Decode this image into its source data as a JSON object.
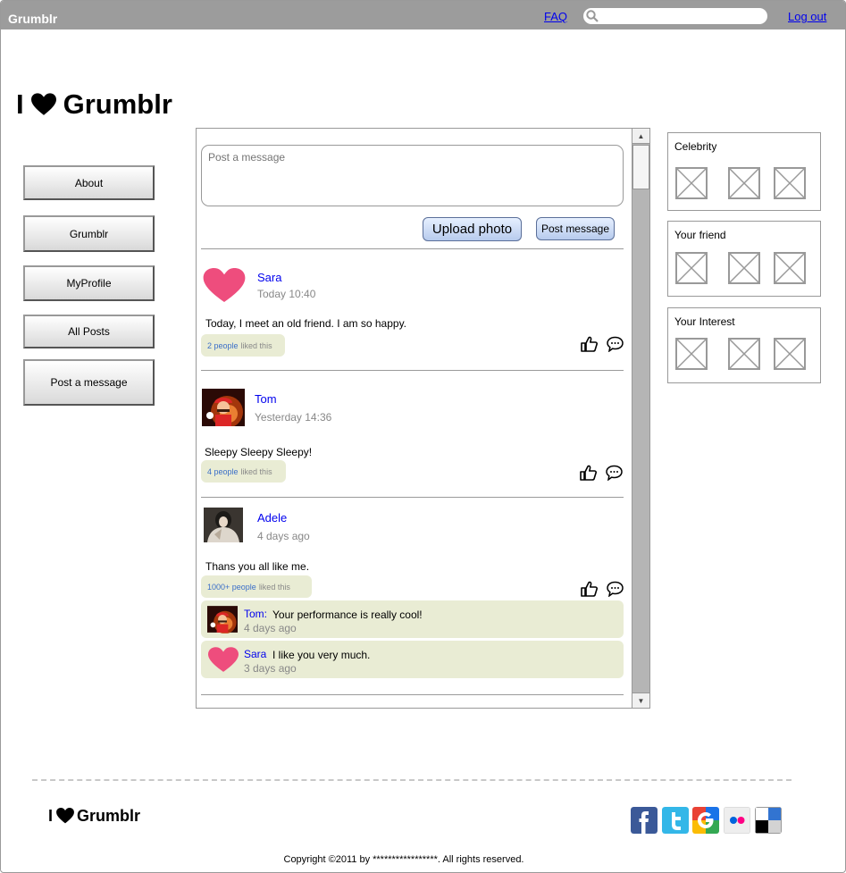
{
  "header": {
    "brand": "Grumblr",
    "faq": "FAQ",
    "search_placeholder": "",
    "logout": "Log out"
  },
  "logo": {
    "prefix": "I",
    "name": "Grumblr"
  },
  "nav": [
    {
      "label": "About"
    },
    {
      "label": "Grumblr"
    },
    {
      "label": "MyProfile"
    },
    {
      "label": "All Posts"
    },
    {
      "label": "Post a message"
    }
  ],
  "compose": {
    "placeholder": "Post a message",
    "upload_label": "Upload photo",
    "post_label": "Post message"
  },
  "posts": [
    {
      "user": "Sara",
      "time": "Today 10:40",
      "avatar": "heart-avatar",
      "text": "Today, I meet an old friend. I am so happy.",
      "likes_count": "2 people",
      "likes_suffix": "liked this"
    },
    {
      "user": "Tom",
      "time": "Yesterday 14:36",
      "avatar": "mario-avatar",
      "text": "Sleepy Sleepy Sleepy!",
      "likes_count": "4 people",
      "likes_suffix": "liked this"
    },
    {
      "user": "Adele",
      "time": "4 days ago",
      "avatar": "adele-photo-avatar",
      "text": "Thans you all like me.",
      "likes_count": "1000+ people",
      "likes_suffix": "liked this",
      "comments": [
        {
          "user": "Tom:",
          "text": "Your performance is really cool!",
          "time": "4 days ago",
          "avatar": "mario-avatar"
        },
        {
          "user": "Sara",
          "text": "I like you very much.",
          "time": "3 days ago",
          "avatar": "heart-avatar"
        }
      ]
    }
  ],
  "sidebar": [
    {
      "title": "Celebrity"
    },
    {
      "title": "Your friend"
    },
    {
      "title": "Your Interest"
    }
  ],
  "footer": {
    "logo_prefix": "I",
    "logo_name": "Grumblr",
    "copyright": "Copyright ©2011 by *****************. All rights reserved.",
    "social": [
      "facebook-icon",
      "twitter-icon",
      "google-icon",
      "flickr-icon",
      "delicious-icon"
    ]
  },
  "colors": {
    "topbar": "#9c9c9c",
    "link": "#0000ee",
    "heart": "#ee4d7d",
    "likes_bg": "#e9ecd4",
    "button_blue": "#b7cbed"
  }
}
